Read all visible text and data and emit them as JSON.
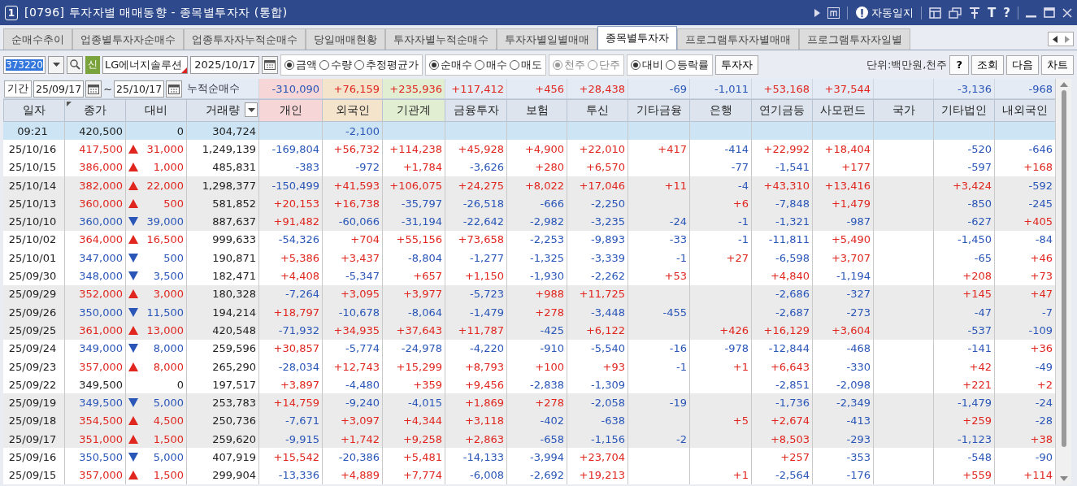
{
  "window": {
    "number": "1",
    "title": "[0796] 투자자별 매매동향 - 종목별투자자 (통합)",
    "journal_button": "자동일지",
    "font_button": "T",
    "help_button": "?"
  },
  "tabs": [
    {
      "label": "순매수추이",
      "selected": false
    },
    {
      "label": "업종별투자자순매수",
      "selected": false
    },
    {
      "label": "업종투자자누적순매수",
      "selected": false
    },
    {
      "label": "당일매매현황",
      "selected": false
    },
    {
      "label": "투자자별누적순매수",
      "selected": false
    },
    {
      "label": "투자자별일별매매",
      "selected": false
    },
    {
      "label": "종목별투자자",
      "selected": true
    },
    {
      "label": "프로그램투자자별매매",
      "selected": false
    },
    {
      "label": "프로그램투자자일별",
      "selected": false
    }
  ],
  "toolbar": {
    "code": "373220",
    "badge": "신",
    "stock_name": "LG에너지솔루션",
    "date": "2025/10/17",
    "radio_groups": [
      {
        "disabled": false,
        "options": [
          {
            "label": "금액",
            "selected": true
          },
          {
            "label": "수량",
            "selected": false
          },
          {
            "label": "추정평균가",
            "selected": false
          }
        ]
      },
      {
        "disabled": false,
        "options": [
          {
            "label": "순매수",
            "selected": true
          },
          {
            "label": "매수",
            "selected": false
          },
          {
            "label": "매도",
            "selected": false
          }
        ]
      },
      {
        "disabled": true,
        "options": [
          {
            "label": "천주",
            "selected": true
          },
          {
            "label": "단주",
            "selected": false
          }
        ]
      },
      {
        "disabled": false,
        "options": [
          {
            "label": "대비",
            "selected": true
          },
          {
            "label": "등락률",
            "selected": false
          }
        ]
      }
    ],
    "investor_button": "투자자",
    "unit": "단위:백만원,천주",
    "help_button": "?",
    "buttons": [
      "조회",
      "다음",
      "차트"
    ]
  },
  "period": {
    "label": "기간",
    "from": "25/09/17",
    "to": "25/10/17",
    "separator": "~",
    "total_label": "누적순매수",
    "totals": {
      "individual": "-310,090",
      "foreign": "+76,159",
      "institution": "+235,936",
      "financial": "+117,412",
      "insurance": "+456",
      "trust": "+28,438",
      "other_finance": "-69",
      "bank": "-1,011",
      "pension": "+53,168",
      "private_fund": "+37,544",
      "other_corp": "-3,136",
      "other_foreign": "-968"
    }
  },
  "columns": [
    {
      "label": "일자"
    },
    {
      "label": "종가"
    },
    {
      "label": "대비"
    },
    {
      "label": "거래량"
    },
    {
      "label": "개인",
      "color": "#f6d6d6"
    },
    {
      "label": "외국인",
      "color": "#f4e4cc"
    },
    {
      "label": "기관계",
      "color": "#e2eed2"
    },
    {
      "label": "금융투자"
    },
    {
      "label": "보험"
    },
    {
      "label": "투신"
    },
    {
      "label": "기타금융"
    },
    {
      "label": "은행"
    },
    {
      "label": "연기금등"
    },
    {
      "label": "사모펀드"
    },
    {
      "label": "국가"
    },
    {
      "label": "기타법인"
    },
    {
      "label": "내외국인"
    }
  ],
  "rows": [
    {
      "date": "09:21",
      "close": "420,500",
      "up": false,
      "down": false,
      "change": "0",
      "volume": "304,724",
      "selected": true,
      "values": {
        "foreign": "-2,100"
      }
    },
    {
      "date": "25/10/16",
      "close": "417,500",
      "up": true,
      "down": false,
      "change": "31,000",
      "volume": "1,249,139",
      "selected": false,
      "shaded": false,
      "values": {
        "individual": "-169,804",
        "foreign": "+56,732",
        "institution": "+114,238",
        "financial": "+45,928",
        "insurance": "+4,900",
        "trust": "+22,010",
        "other_finance": "+417",
        "bank": "-414",
        "pension": "+22,992",
        "private_fund": "+18,404",
        "other_corp": "-520",
        "other_foreign": "-646"
      }
    },
    {
      "date": "25/10/15",
      "close": "386,000",
      "up": true,
      "down": false,
      "change": "1,000",
      "volume": "485,831",
      "selected": false,
      "shaded": false,
      "values": {
        "individual": "-383",
        "foreign": "-972",
        "institution": "+1,784",
        "financial": "-3,626",
        "insurance": "+280",
        "trust": "+6,570",
        "bank": "-77",
        "pension": "-1,541",
        "private_fund": "+177",
        "other_corp": "-597",
        "other_foreign": "+168"
      }
    },
    {
      "date": "25/10/14",
      "close": "382,000",
      "up": true,
      "down": false,
      "change": "22,000",
      "volume": "1,298,377",
      "selected": false,
      "shaded": true,
      "values": {
        "individual": "-150,499",
        "foreign": "+41,593",
        "institution": "+106,075",
        "financial": "+24,275",
        "insurance": "+8,022",
        "trust": "+17,046",
        "other_finance": "+11",
        "bank": "-4",
        "pension": "+43,310",
        "private_fund": "+13,416",
        "other_corp": "+3,424",
        "other_foreign": "-592"
      }
    },
    {
      "date": "25/10/13",
      "close": "360,000",
      "up": true,
      "down": false,
      "change": "500",
      "volume": "581,852",
      "selected": false,
      "shaded": true,
      "values": {
        "individual": "+20,153",
        "foreign": "+16,738",
        "institution": "-35,797",
        "financial": "-26,518",
        "insurance": "-666",
        "trust": "-2,250",
        "bank": "+6",
        "pension": "-7,848",
        "private_fund": "+1,479",
        "other_corp": "-850",
        "other_foreign": "-245"
      }
    },
    {
      "date": "25/10/10",
      "close": "360,000",
      "up": false,
      "down": true,
      "change": "39,000",
      "volume": "887,637",
      "selected": false,
      "shaded": true,
      "values": {
        "individual": "+91,482",
        "foreign": "-60,066",
        "institution": "-31,194",
        "financial": "-22,642",
        "insurance": "-2,982",
        "trust": "-3,235",
        "other_finance": "-24",
        "bank": "-1",
        "pension": "-1,321",
        "private_fund": "-987",
        "other_corp": "-627",
        "other_foreign": "+405"
      }
    },
    {
      "date": "25/10/02",
      "close": "364,000",
      "up": true,
      "down": false,
      "change": "16,500",
      "volume": "999,633",
      "selected": false,
      "shaded": false,
      "values": {
        "individual": "-54,326",
        "foreign": "+704",
        "institution": "+55,156",
        "financial": "+73,658",
        "insurance": "-2,253",
        "trust": "-9,893",
        "other_finance": "-33",
        "bank": "-1",
        "pension": "-11,811",
        "private_fund": "+5,490",
        "other_corp": "-1,450",
        "other_foreign": "-84"
      }
    },
    {
      "date": "25/10/01",
      "close": "347,000",
      "up": false,
      "down": true,
      "change": "500",
      "volume": "190,871",
      "selected": false,
      "shaded": false,
      "values": {
        "individual": "+5,386",
        "foreign": "+3,437",
        "institution": "-8,804",
        "financial": "-1,277",
        "insurance": "-1,325",
        "trust": "-3,339",
        "other_finance": "-1",
        "bank": "+27",
        "pension": "-6,598",
        "private_fund": "+3,707",
        "other_corp": "-65",
        "other_foreign": "+46"
      }
    },
    {
      "date": "25/09/30",
      "close": "348,000",
      "up": false,
      "down": true,
      "change": "3,500",
      "volume": "182,471",
      "selected": false,
      "shaded": false,
      "values": {
        "individual": "+4,408",
        "foreign": "-5,347",
        "institution": "+657",
        "financial": "+1,150",
        "insurance": "-1,930",
        "trust": "-2,262",
        "other_finance": "+53",
        "pension": "+4,840",
        "private_fund": "-1,194",
        "other_corp": "+208",
        "other_foreign": "+73"
      }
    },
    {
      "date": "25/09/29",
      "close": "352,000",
      "up": true,
      "down": false,
      "change": "3,000",
      "volume": "180,328",
      "selected": false,
      "shaded": true,
      "values": {
        "individual": "-7,264",
        "foreign": "+3,095",
        "institution": "+3,977",
        "financial": "-5,723",
        "insurance": "+988",
        "trust": "+11,725",
        "pension": "-2,686",
        "private_fund": "-327",
        "other_corp": "+145",
        "other_foreign": "+47"
      }
    },
    {
      "date": "25/09/26",
      "close": "350,000",
      "up": false,
      "down": true,
      "change": "11,500",
      "volume": "194,214",
      "selected": false,
      "shaded": true,
      "values": {
        "individual": "+18,797",
        "foreign": "-10,678",
        "institution": "-8,064",
        "financial": "-1,479",
        "insurance": "+278",
        "trust": "-3,448",
        "other_finance": "-455",
        "pension": "-2,687",
        "private_fund": "-273",
        "other_corp": "-47",
        "other_foreign": "-7"
      }
    },
    {
      "date": "25/09/25",
      "close": "361,000",
      "up": true,
      "down": false,
      "change": "13,000",
      "volume": "420,548",
      "selected": false,
      "shaded": true,
      "values": {
        "individual": "-71,932",
        "foreign": "+34,935",
        "institution": "+37,643",
        "financial": "+11,787",
        "insurance": "-425",
        "trust": "+6,122",
        "bank": "+426",
        "pension": "+16,129",
        "private_fund": "+3,604",
        "other_corp": "-537",
        "other_foreign": "-109"
      }
    },
    {
      "date": "25/09/24",
      "close": "349,000",
      "up": false,
      "down": true,
      "change": "8,000",
      "volume": "259,596",
      "selected": false,
      "shaded": false,
      "values": {
        "individual": "+30,857",
        "foreign": "-5,774",
        "institution": "-24,978",
        "financial": "-4,220",
        "insurance": "-910",
        "trust": "-5,540",
        "other_finance": "-16",
        "bank": "-978",
        "pension": "-12,844",
        "private_fund": "-468",
        "other_corp": "-141",
        "other_foreign": "+36"
      }
    },
    {
      "date": "25/09/23",
      "close": "357,000",
      "up": true,
      "down": false,
      "change": "8,000",
      "volume": "265,290",
      "selected": false,
      "shaded": false,
      "values": {
        "individual": "-28,034",
        "foreign": "+12,743",
        "institution": "+15,299",
        "financial": "+8,793",
        "insurance": "+100",
        "trust": "+93",
        "other_finance": "-1",
        "bank": "+1",
        "pension": "+6,643",
        "private_fund": "-330",
        "other_corp": "+42",
        "other_foreign": "-49"
      }
    },
    {
      "date": "25/09/22",
      "close": "349,500",
      "up": false,
      "down": false,
      "change": "0",
      "volume": "197,517",
      "selected": false,
      "shaded": false,
      "values": {
        "individual": "+3,897",
        "foreign": "-4,480",
        "institution": "+359",
        "financial": "+9,456",
        "insurance": "-2,838",
        "trust": "-1,309",
        "pension": "-2,851",
        "private_fund": "-2,098",
        "other_corp": "+221",
        "other_foreign": "+2"
      }
    },
    {
      "date": "25/09/19",
      "close": "349,500",
      "up": false,
      "down": true,
      "change": "5,000",
      "volume": "253,783",
      "selected": false,
      "shaded": true,
      "values": {
        "individual": "+14,759",
        "foreign": "-9,240",
        "institution": "-4,015",
        "financial": "+1,869",
        "insurance": "+278",
        "trust": "-2,058",
        "other_finance": "-19",
        "pension": "-1,736",
        "private_fund": "-2,349",
        "other_corp": "-1,479",
        "other_foreign": "-24"
      }
    },
    {
      "date": "25/09/18",
      "close": "354,500",
      "up": true,
      "down": false,
      "change": "4,500",
      "volume": "250,736",
      "selected": false,
      "shaded": true,
      "values": {
        "individual": "-7,671",
        "foreign": "+3,097",
        "institution": "+4,344",
        "financial": "+3,118",
        "insurance": "-402",
        "trust": "-638",
        "bank": "+5",
        "pension": "+2,674",
        "private_fund": "-413",
        "other_corp": "+259",
        "other_foreign": "-28"
      }
    },
    {
      "date": "25/09/17",
      "close": "351,000",
      "up": true,
      "down": false,
      "change": "1,500",
      "volume": "259,620",
      "selected": false,
      "shaded": true,
      "values": {
        "individual": "-9,915",
        "foreign": "+1,742",
        "institution": "+9,258",
        "financial": "+2,863",
        "insurance": "-658",
        "trust": "-1,156",
        "other_finance": "-2",
        "pension": "+8,503",
        "private_fund": "-293",
        "other_corp": "-1,123",
        "other_foreign": "+38"
      }
    },
    {
      "date": "25/09/16",
      "close": "350,500",
      "up": false,
      "down": true,
      "change": "5,000",
      "volume": "407,919",
      "selected": false,
      "shaded": false,
      "values": {
        "individual": "+15,542",
        "foreign": "-20,386",
        "institution": "+5,481",
        "financial": "-14,133",
        "insurance": "-3,994",
        "trust": "+23,704",
        "pension": "+257",
        "private_fund": "-353",
        "other_corp": "-548",
        "other_foreign": "-90"
      }
    },
    {
      "date": "25/09/15",
      "close": "357,000",
      "up": true,
      "down": false,
      "change": "1,500",
      "volume": "299,904",
      "selected": false,
      "shaded": false,
      "values": {
        "individual": "-13,336",
        "foreign": "+4,889",
        "institution": "+7,774",
        "financial": "-6,008",
        "insurance": "-2,692",
        "trust": "+19,213",
        "bank": "+1",
        "pension": "-2,564",
        "private_fund": "-176",
        "other_corp": "+559",
        "other_foreign": "+114"
      }
    }
  ]
}
